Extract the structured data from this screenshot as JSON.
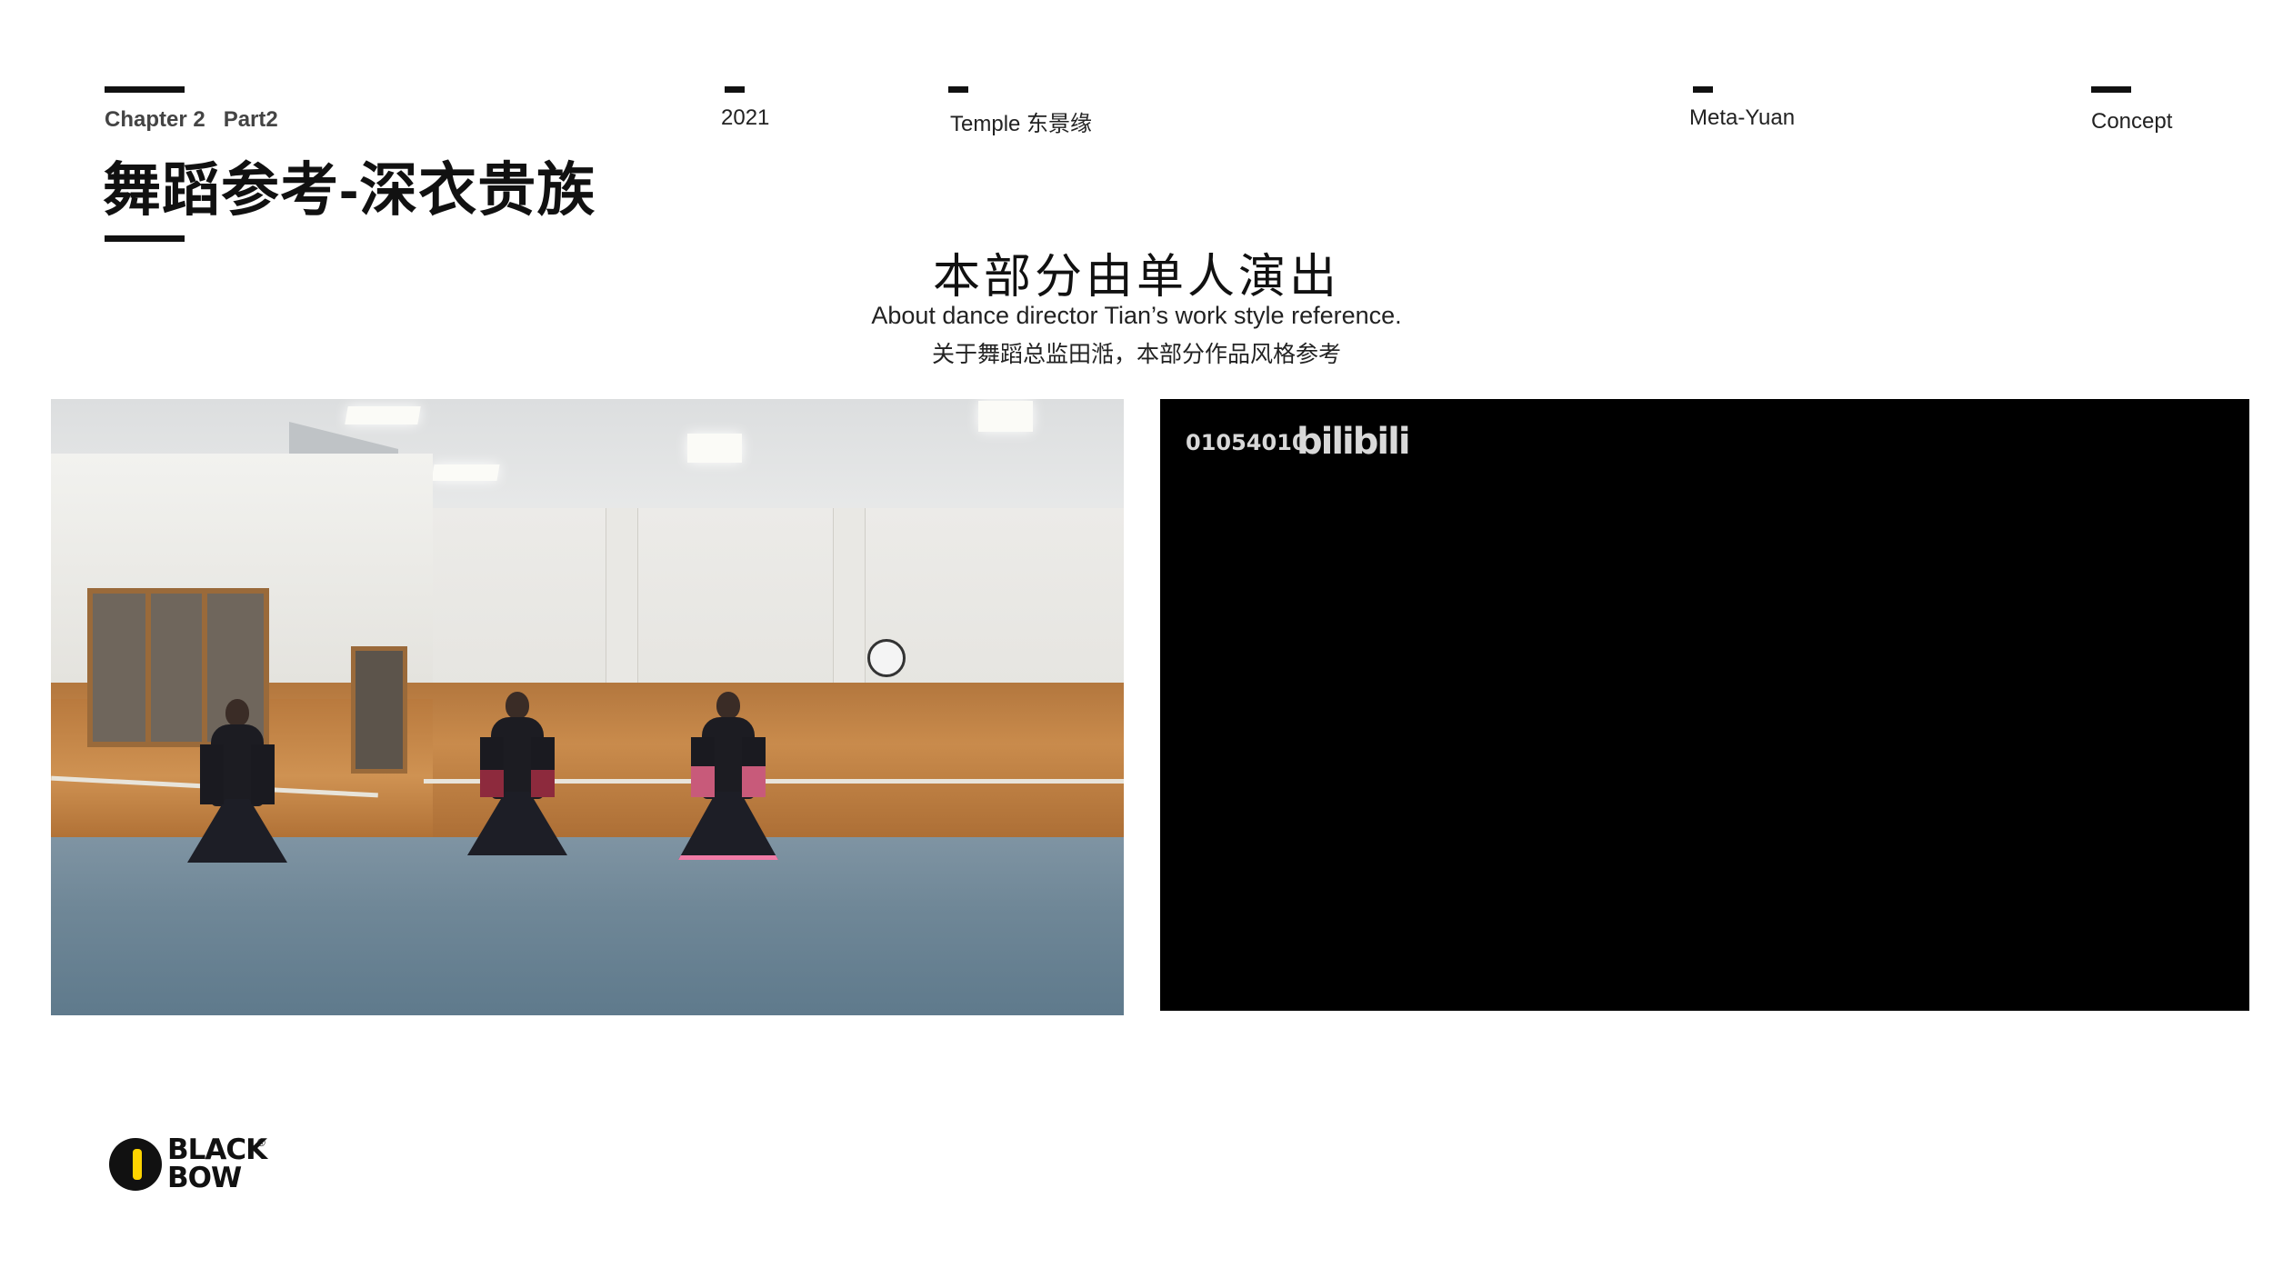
{
  "header": {
    "chapter": "Chapter 2",
    "part": "Part2",
    "title": "舞蹈参考-深衣贵族"
  },
  "nav": {
    "year": "2021",
    "temple": "Temple 东景缘",
    "meta": "Meta-Yuan",
    "concept": "Concept"
  },
  "intro": {
    "heading": "本部分由单人演出",
    "english": "About dance director Tian’s work style reference.",
    "chinese": "关于舞蹈总监田湉，本部分作品风格参考"
  },
  "video_right": {
    "id": "01054010",
    "logo": "bilibili"
  },
  "brand": {
    "line1": "BLACK",
    "line2": "BOW",
    "reg": "®",
    "accent_color": "#ffd400"
  }
}
